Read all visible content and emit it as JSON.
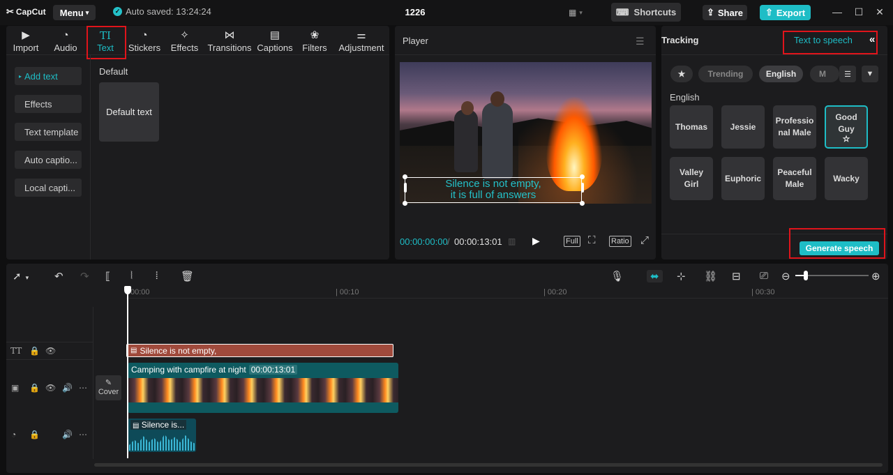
{
  "titlebar": {
    "logo": "CapCut",
    "menu": "Menu",
    "autosave": "Auto saved: 13:24:24",
    "project": "1226",
    "shortcuts": "Shortcuts",
    "share": "Share",
    "export": "Export"
  },
  "media_tabs": [
    {
      "label": "Import",
      "icon": "import-icon"
    },
    {
      "label": "Audio",
      "icon": "audio-icon"
    },
    {
      "label": "Text",
      "icon": "text-icon",
      "glyph": "TI"
    },
    {
      "label": "Stickers",
      "icon": "sticker-icon"
    },
    {
      "label": "Effects",
      "icon": "effects-icon"
    },
    {
      "label": "Transitions",
      "icon": "transition-icon"
    },
    {
      "label": "Captions",
      "icon": "captions-icon"
    },
    {
      "label": "Filters",
      "icon": "filters-icon"
    },
    {
      "label": "Adjustment",
      "icon": "adjustment-icon"
    }
  ],
  "text_nav": [
    "Add text",
    "Effects",
    "Text template",
    "Auto captio...",
    "Local capti..."
  ],
  "text_panel": {
    "section": "Default",
    "card": "Default text"
  },
  "player": {
    "title": "Player",
    "subtitle_line1": "Silence is not empty,",
    "subtitle_line2": "it is full of answers",
    "time_current": "00:00:00:00",
    "time_total": "00:00:13:01",
    "full": "Full",
    "ratio": "Ratio"
  },
  "right_panel": {
    "tab_tracking": "Tracking",
    "tab_tts": "Text to speech",
    "chips": [
      "Trending",
      "English",
      "M"
    ],
    "language_heading": "English",
    "voices": [
      "Thomas",
      "Jessie",
      "Professio nal Male",
      "Good Guy",
      "Valley Girl",
      "Euphoric",
      "Peaceful Male",
      "Wacky"
    ],
    "selected_voice": "Good Guy",
    "generate": "Generate speech"
  },
  "timeline": {
    "ticks": [
      "00:00",
      "00:10",
      "00:20",
      "00:30"
    ],
    "text_clip": "Silence is not empty,",
    "video_clip": "Camping with campfire at night",
    "video_duration": "00:00:13:01",
    "audio_clip": "Silence is...",
    "cover": "Cover"
  },
  "colors": {
    "accent": "#1ebdc6",
    "highlight_box": "#e0141b",
    "text_clip": "#a04a3c",
    "video_clip": "#0e5a60"
  }
}
